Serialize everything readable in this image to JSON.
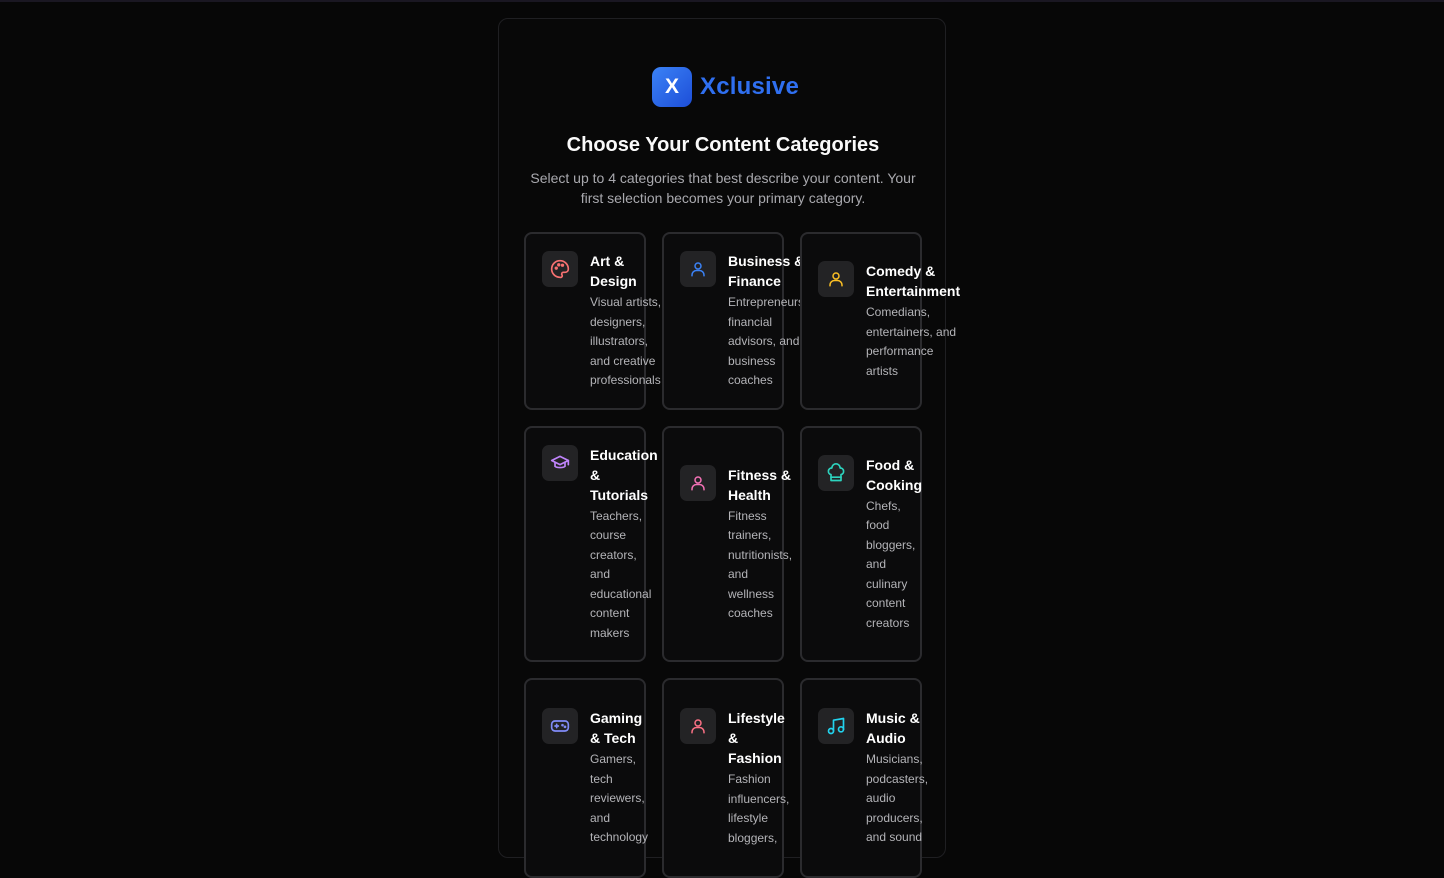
{
  "brand": {
    "logo_letter": "X",
    "name": "Xclusive"
  },
  "header": {
    "title": "Choose Your Content Categories",
    "subtitle": "Select up to 4 categories that best describe your content. Your first selection becomes your primary category."
  },
  "categories": [
    {
      "name_lines": [
        "Art &",
        "Design"
      ],
      "desc_lines": [
        "Visual artists,",
        "designers,",
        "illustrators,",
        "and creative",
        "professionals"
      ],
      "icon": "palette-icon",
      "color": "#f87171"
    },
    {
      "name_lines": [
        "Business &",
        "Finance"
      ],
      "desc_lines": [
        "Entrepreneurs,",
        "financial",
        "advisors, and",
        "business",
        "coaches"
      ],
      "icon": "user-icon",
      "color": "#3b82f6"
    },
    {
      "name_lines": [
        "Comedy &",
        "Entertainment"
      ],
      "desc_lines": [
        "Comedians,",
        "entertainers, and",
        "performance",
        "artists"
      ],
      "icon": "user-icon",
      "color": "#fbbf24"
    },
    {
      "name_lines": [
        "Education",
        "&",
        "Tutorials"
      ],
      "desc_lines": [
        "Teachers,",
        "course",
        "creators,",
        "and",
        "educational",
        "content",
        "makers"
      ],
      "icon": "graduation-cap-icon",
      "color": "#c084fc"
    },
    {
      "name_lines": [
        "Fitness &",
        "Health"
      ],
      "desc_lines": [
        "Fitness",
        "trainers,",
        "nutritionists,",
        "and",
        "wellness",
        "coaches"
      ],
      "icon": "user-icon",
      "color": "#f472b6"
    },
    {
      "name_lines": [
        "Food &",
        "Cooking"
      ],
      "desc_lines": [
        "Chefs,",
        "food",
        "bloggers,",
        "and",
        "culinary",
        "content",
        "creators"
      ],
      "icon": "chef-hat-icon",
      "color": "#2dd4bf"
    },
    {
      "name_lines": [
        "Gaming",
        "& Tech"
      ],
      "desc_lines": [
        "Gamers,",
        "tech",
        "reviewers,",
        "and",
        "technology"
      ],
      "icon": "gamepad-icon",
      "color": "#818cf8"
    },
    {
      "name_lines": [
        "Lifestyle",
        "&",
        "Fashion"
      ],
      "desc_lines": [
        "Fashion",
        "influencers,",
        "lifestyle",
        "bloggers,"
      ],
      "icon": "user-icon",
      "color": "#fb7185"
    },
    {
      "name_lines": [
        "Music &",
        "Audio"
      ],
      "desc_lines": [
        "Musicians,",
        "podcasters,",
        "audio",
        "producers,",
        "and sound"
      ],
      "icon": "music-note-icon",
      "color": "#22d3ee"
    }
  ]
}
